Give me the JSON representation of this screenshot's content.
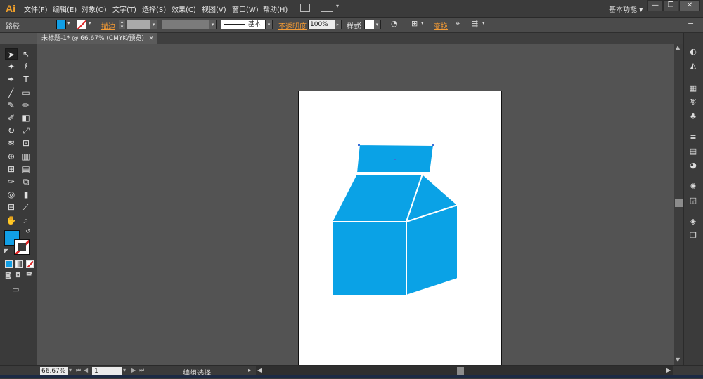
{
  "app": {
    "logo": "Ai"
  },
  "menu": [
    "文件(F)",
    "编辑(E)",
    "对象(O)",
    "文字(T)",
    "选择(S)",
    "效果(C)",
    "视图(V)",
    "窗口(W)",
    "帮助(H)"
  ],
  "workspace": {
    "label": "基本功能",
    "arrow": "▾"
  },
  "window_buttons": {
    "minimize": "—",
    "restore": "❐",
    "close": "✕"
  },
  "control_bar": {
    "selection_type": "路径",
    "fill_color": "#119fe6",
    "stroke_label": "描边",
    "stroke_style_label": "基本",
    "opacity_label": "不透明度",
    "opacity_value": "100%",
    "style_label": "样式",
    "transform_label": "变换"
  },
  "document_tab": {
    "title": "未标题-1* @ 66.67% (CMYK/预览)",
    "close": "×"
  },
  "artwork": {
    "fill": "#0aa2e6",
    "stroke": "#ffffff"
  },
  "tools": {
    "fill_color": "#119fe6",
    "icons": [
      "selection-tool-icon",
      "direct-selection-tool-icon",
      "magic-wand-tool-icon",
      "lasso-tool-icon",
      "pen-tool-icon",
      "type-tool-icon",
      "line-tool-icon",
      "rectangle-tool-icon",
      "paintbrush-tool-icon",
      "pencil-tool-icon",
      "blob-brush-tool-icon",
      "eraser-tool-icon",
      "rotate-tool-icon",
      "scale-tool-icon",
      "warp-tool-icon",
      "free-transform-tool-icon",
      "shape-builder-tool-icon",
      "perspective-grid-tool-icon",
      "mesh-tool-icon",
      "gradient-tool-icon",
      "eyedropper-tool-icon",
      "blend-tool-icon",
      "symbol-sprayer-tool-icon",
      "column-graph-tool-icon",
      "artboard-tool-icon",
      "slice-tool-icon",
      "hand-tool-icon",
      "zoom-tool-icon"
    ]
  },
  "status_bar": {
    "zoom": "66.67%",
    "page": "1",
    "status": "编组选择"
  }
}
